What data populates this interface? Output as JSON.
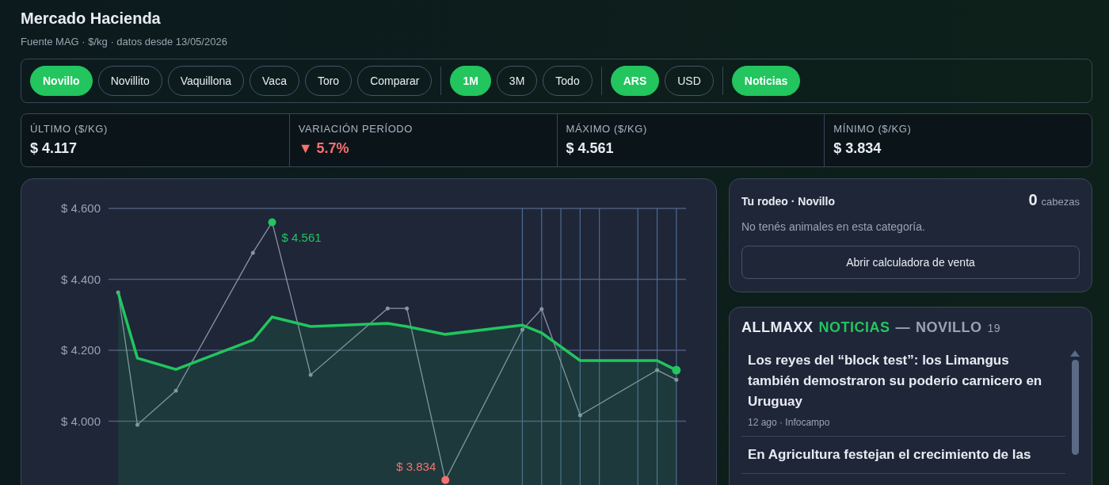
{
  "header": {
    "title": "Mercado Hacienda",
    "subtitle": "Fuente MAG · $/kg · datos desde 13/05/2026"
  },
  "filters": [
    {
      "items": [
        {
          "label": "Novillo",
          "selected": true
        },
        {
          "label": "Novillito",
          "selected": false
        },
        {
          "label": "Vaquillona",
          "selected": false
        },
        {
          "label": "Vaca",
          "selected": false
        },
        {
          "label": "Toro",
          "selected": false
        },
        {
          "label": "Comparar",
          "selected": false
        }
      ]
    },
    {
      "items": [
        {
          "label": "1M",
          "selected": true
        },
        {
          "label": "3M",
          "selected": false
        },
        {
          "label": "Todo",
          "selected": false
        }
      ]
    },
    {
      "items": [
        {
          "label": "ARS",
          "selected": true
        },
        {
          "label": "USD",
          "selected": false
        }
      ]
    },
    {
      "items": [
        {
          "label": "Noticias",
          "selected": true
        }
      ]
    }
  ],
  "stats": [
    {
      "label": "ÚLTIMO ($/KG)",
      "value": "$ 4.117"
    },
    {
      "label": "VARIACIÓN PERÍODO",
      "value": "5.7%",
      "arrow": "▼"
    },
    {
      "label": "MÁXIMO ($/KG)",
      "value": "$ 4.561"
    },
    {
      "label": "MÍNIMO ($/KG)",
      "value": "$ 3.834"
    }
  ],
  "chart_data": {
    "type": "line",
    "grid": true,
    "ylim": [
      3.8,
      4.6
    ],
    "yticks": [
      {
        "value": 4.0,
        "label": "$ 4.000"
      },
      {
        "value": 4.2,
        "label": "$ 4.200"
      },
      {
        "value": 4.4,
        "label": "$ 4.400"
      },
      {
        "value": 4.6,
        "label": "$ 4.600"
      }
    ],
    "series": [
      {
        "type": "line",
        "color": "#8a93a3",
        "values": [
          4.363,
          3.99,
          null,
          4.086,
          null,
          null,
          null,
          4.475,
          4.561,
          null,
          4.131,
          null,
          null,
          null,
          4.318,
          4.318,
          null,
          3.834,
          null,
          null,
          null,
          4.258,
          4.316,
          null,
          4.017,
          null,
          null,
          null,
          4.144,
          4.117
        ]
      },
      {
        "type": "area",
        "color": "#22c55e",
        "values": [
          4.363,
          4.178,
          null,
          4.146,
          null,
          null,
          null,
          4.229,
          4.294,
          null,
          4.267,
          null,
          null,
          null,
          4.276,
          4.267,
          null,
          4.245,
          null,
          null,
          null,
          4.271,
          4.249,
          null,
          4.171,
          null,
          null,
          null,
          4.171,
          4.144
        ]
      }
    ],
    "annotations": [
      "$ 4.561",
      "$ 3.834"
    ]
  },
  "rodeo": {
    "title": "Tu rodeo · Novillo",
    "count": "0",
    "count_unit": "cabezas",
    "message": "No tenés animales en esta categoría.",
    "button": "Abrir calculadora de venta"
  },
  "news": {
    "brand": "ALLMAXX",
    "section": "NOTICIAS",
    "separator": "—",
    "category": "NOVILLO",
    "count": "19",
    "items": [
      {
        "title": "Los reyes del “block test”: los Limangus también demostraron su poderío carnicero en Uruguay",
        "meta": "12 ago · Infocampo"
      },
      {
        "title": "En Agricultura festejan el crecimiento de las"
      }
    ]
  }
}
